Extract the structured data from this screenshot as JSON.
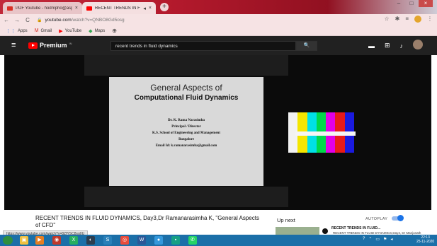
{
  "browser": {
    "tabs": [
      {
        "title": "PDF Youtube - hodmpho@aspir...",
        "active": false
      },
      {
        "title": "RECENT TRENDS IN FLUID D",
        "active": true
      }
    ],
    "new_tab": "+",
    "address_host": "youtube.com",
    "address_path": "/watch?v=QNBO8Gd5osg",
    "bookmarks": [
      {
        "label": "Apps",
        "icon": "apps-grid-icon"
      },
      {
        "label": "Gmail",
        "icon": "gmail-icon"
      },
      {
        "label": "YouTube",
        "icon": "youtube-icon"
      },
      {
        "label": "Maps",
        "icon": "maps-icon"
      }
    ]
  },
  "youtube": {
    "logo_text": "Premium",
    "search_value": "recent trends in fluid dynamics",
    "search_button": "🔍"
  },
  "slide": {
    "title_line1": "General Aspects of",
    "title_line2": "Computational Fluid Dynamics",
    "author": "Dr. K. Rama Narasimha",
    "position": "Principal / Director",
    "institution": "K.S. School of Engineering and Management",
    "city": "Bangalore",
    "email": "Email Id: k.ramanarasimha@gmail.com"
  },
  "colors": {
    "test_bars": [
      "#f2f2f2",
      "#f4e600",
      "#00e0e6",
      "#00d84a",
      "#e200e8",
      "#e81a1a",
      "#1a1adf"
    ]
  },
  "video": {
    "title": "RECENT TRENDS IN FLUID DYNAMICS, Day3,Dr Ramanarasimha K, \"General Aspects of CFD\""
  },
  "sidebar": {
    "up_next": "Up next",
    "autoplay": "AUTOPLAY",
    "next_title": "RECENT TRENDS IN FLUID...",
    "next_subtitle": "RECENT TRENDS IN FLUID DYNAMICS,Day4, Dr Manjunath"
  },
  "status": {
    "hover_url": "https://www.youtube.com/watch?v=8ZfYSC8sg0U"
  },
  "taskbar": {
    "time": "22:13",
    "date": "25-11-2020"
  }
}
